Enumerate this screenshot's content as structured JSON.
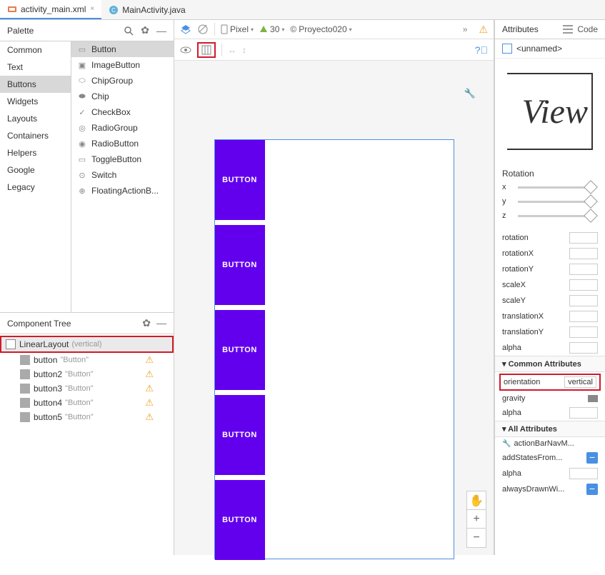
{
  "tabs": [
    {
      "label": "activity_main.xml",
      "active": true
    },
    {
      "label": "MainActivity.java",
      "active": false
    }
  ],
  "code_label": "Code",
  "palette": {
    "title": "Palette",
    "categories": [
      "Common",
      "Text",
      "Buttons",
      "Widgets",
      "Layouts",
      "Containers",
      "Helpers",
      "Google",
      "Legacy"
    ],
    "selected_category": "Buttons",
    "components": [
      "Button",
      "ImageButton",
      "ChipGroup",
      "Chip",
      "CheckBox",
      "RadioGroup",
      "RadioButton",
      "ToggleButton",
      "Switch",
      "FloatingActionB..."
    ],
    "selected_component": "Button"
  },
  "tree": {
    "title": "Component Tree",
    "root": {
      "label": "LinearLayout",
      "sub": "(vertical)"
    },
    "children": [
      {
        "label": "button",
        "sub": "\"Button\""
      },
      {
        "label": "button2",
        "sub": "\"Button\""
      },
      {
        "label": "button3",
        "sub": "\"Button\""
      },
      {
        "label": "button4",
        "sub": "\"Button\""
      },
      {
        "label": "button5",
        "sub": "\"Button\""
      }
    ]
  },
  "design_toolbar": {
    "device": "Pixel",
    "api": "30",
    "project": "Proyecto020"
  },
  "mock_buttons": [
    "BUTTON",
    "BUTTON",
    "BUTTON",
    "BUTTON",
    "BUTTON"
  ],
  "attributes": {
    "title": "Attributes",
    "name": "<unnamed>",
    "preview": "View",
    "rotation_title": "Rotation",
    "sliders": [
      "x",
      "y",
      "z"
    ],
    "transform_rows": [
      "rotation",
      "rotationX",
      "rotationY",
      "scaleX",
      "scaleY",
      "translationX",
      "translationY",
      "alpha"
    ],
    "common_title": "Common Attributes",
    "orientation_label": "orientation",
    "orientation_value": "vertical",
    "common_rows": [
      "gravity",
      "alpha"
    ],
    "all_title": "All Attributes",
    "all_rows": [
      "actionBarNavM...",
      "addStatesFrom...",
      "alpha",
      "alwaysDrawnWi..."
    ]
  }
}
